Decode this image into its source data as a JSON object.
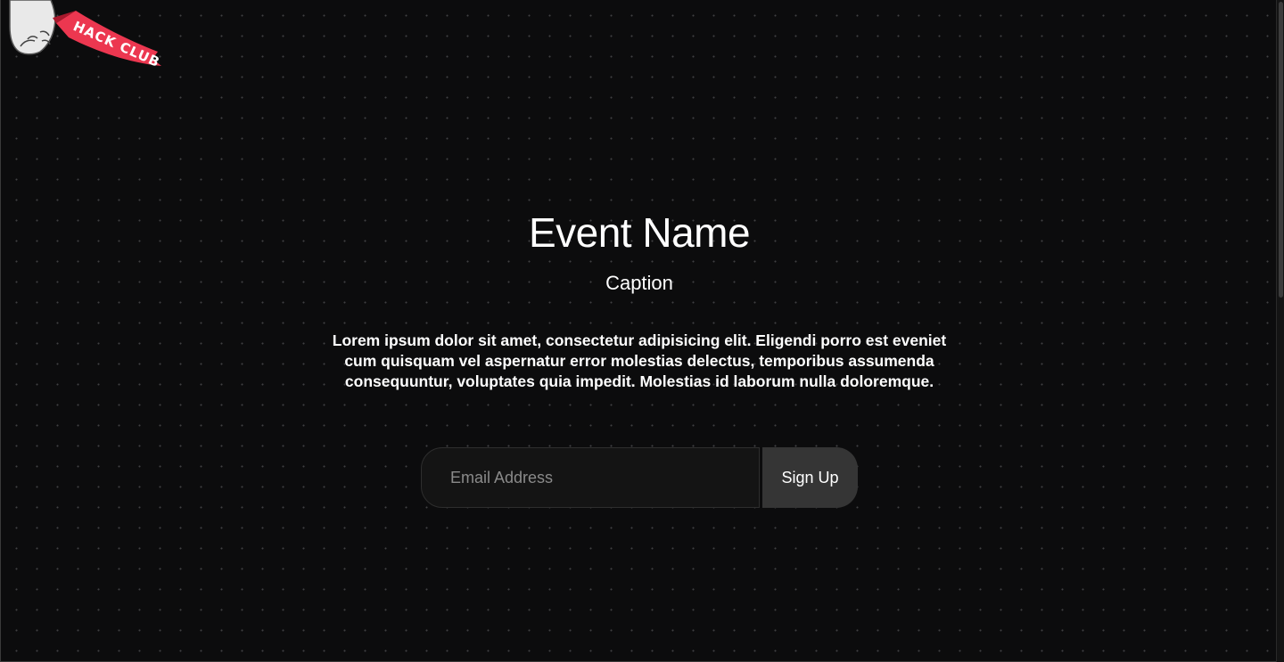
{
  "banner": {
    "text": "HACK CLUB",
    "brand_color": "#ec3750"
  },
  "hero": {
    "title": "Event Name",
    "caption": "Caption",
    "description": "Lorem ipsum dolor sit amet, consectetur adipisicing elit. Eligendi porro est eveniet cum quisquam vel aspernatur error molestias delectus, temporibus assumenda consequuntur, voluptates quia impedit. Molestias id laborum nulla doloremque."
  },
  "signup": {
    "email_placeholder": "Email Address",
    "email_value": "",
    "button_label": "Sign Up"
  },
  "colors": {
    "background": "#0c0c0d",
    "input_background": "#141414",
    "button_background": "#353535"
  }
}
